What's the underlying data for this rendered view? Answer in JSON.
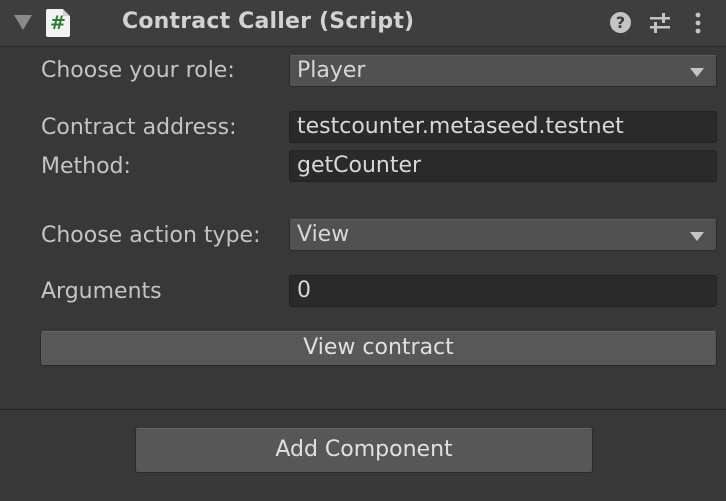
{
  "header": {
    "title": "Contract Caller (Script)",
    "script_icon_glyph": "#",
    "help_glyph": "?",
    "icons": [
      "foldout-arrow-icon",
      "script-icon",
      "help-icon",
      "preset-icon",
      "context-menu-icon"
    ]
  },
  "fields": {
    "role": {
      "label": "Choose your role:",
      "value": "Player"
    },
    "contract_address": {
      "label": "Contract address:",
      "value": "testcounter.metaseed.testnet"
    },
    "method": {
      "label": "Method:",
      "value": "getCounter"
    },
    "action_type": {
      "label": "Choose action type:",
      "value": "View"
    },
    "arguments": {
      "label": "Arguments",
      "value": "0"
    }
  },
  "buttons": {
    "view_contract": "View contract",
    "add_component": "Add Component"
  },
  "colors": {
    "background": "#383838",
    "header": "#3e3e3e",
    "text_field": "#2a2a2a",
    "dropdown": "#515151",
    "button": "#585858",
    "script_icon_hash": "#2e7d32"
  }
}
